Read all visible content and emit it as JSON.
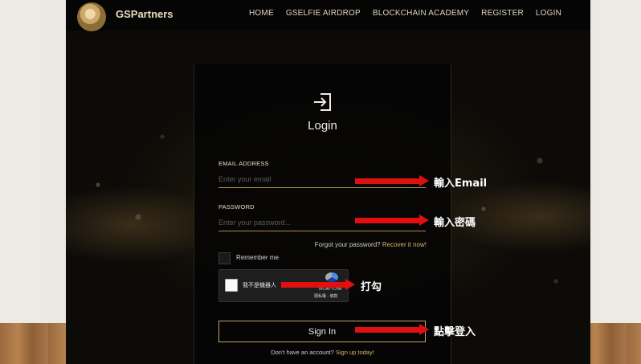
{
  "nav": {
    "brand": "GSPartners",
    "items": [
      "HOME",
      "GSELFIE AIRDROP",
      "BLOCKCHAIN ACADEMY",
      "REGISTER",
      "LOGIN"
    ]
  },
  "login": {
    "title": "Login",
    "email_label": "EMAIL ADDRESS",
    "email_placeholder": "Enter your email",
    "password_label": "PASSWORD",
    "password_placeholder": "Enter your password...",
    "forgot_text": "Forgot your password?",
    "forgot_link": "Recover it now!",
    "remember_label": "Remember me",
    "signin_label": "Sign In",
    "signup_text": "Don't have an account?",
    "signup_link": "Sign up today!"
  },
  "recaptcha": {
    "label": "我不是機器人",
    "brand": "reCAPTCHA",
    "terms": "隱私權 - 條款"
  },
  "annotations": {
    "email_note": "輸入Email",
    "password_note": "輸入密碼",
    "captcha_note": "打勾",
    "signin_note": "點擊登入"
  },
  "colors": {
    "accent_gold": "#bfa36b",
    "arrow_red": "#e01010",
    "link_gold": "#d8b76e"
  },
  "icons": [
    "logo-icon",
    "login-icon",
    "recaptcha-logo-icon",
    "red-arrow-icon"
  ]
}
